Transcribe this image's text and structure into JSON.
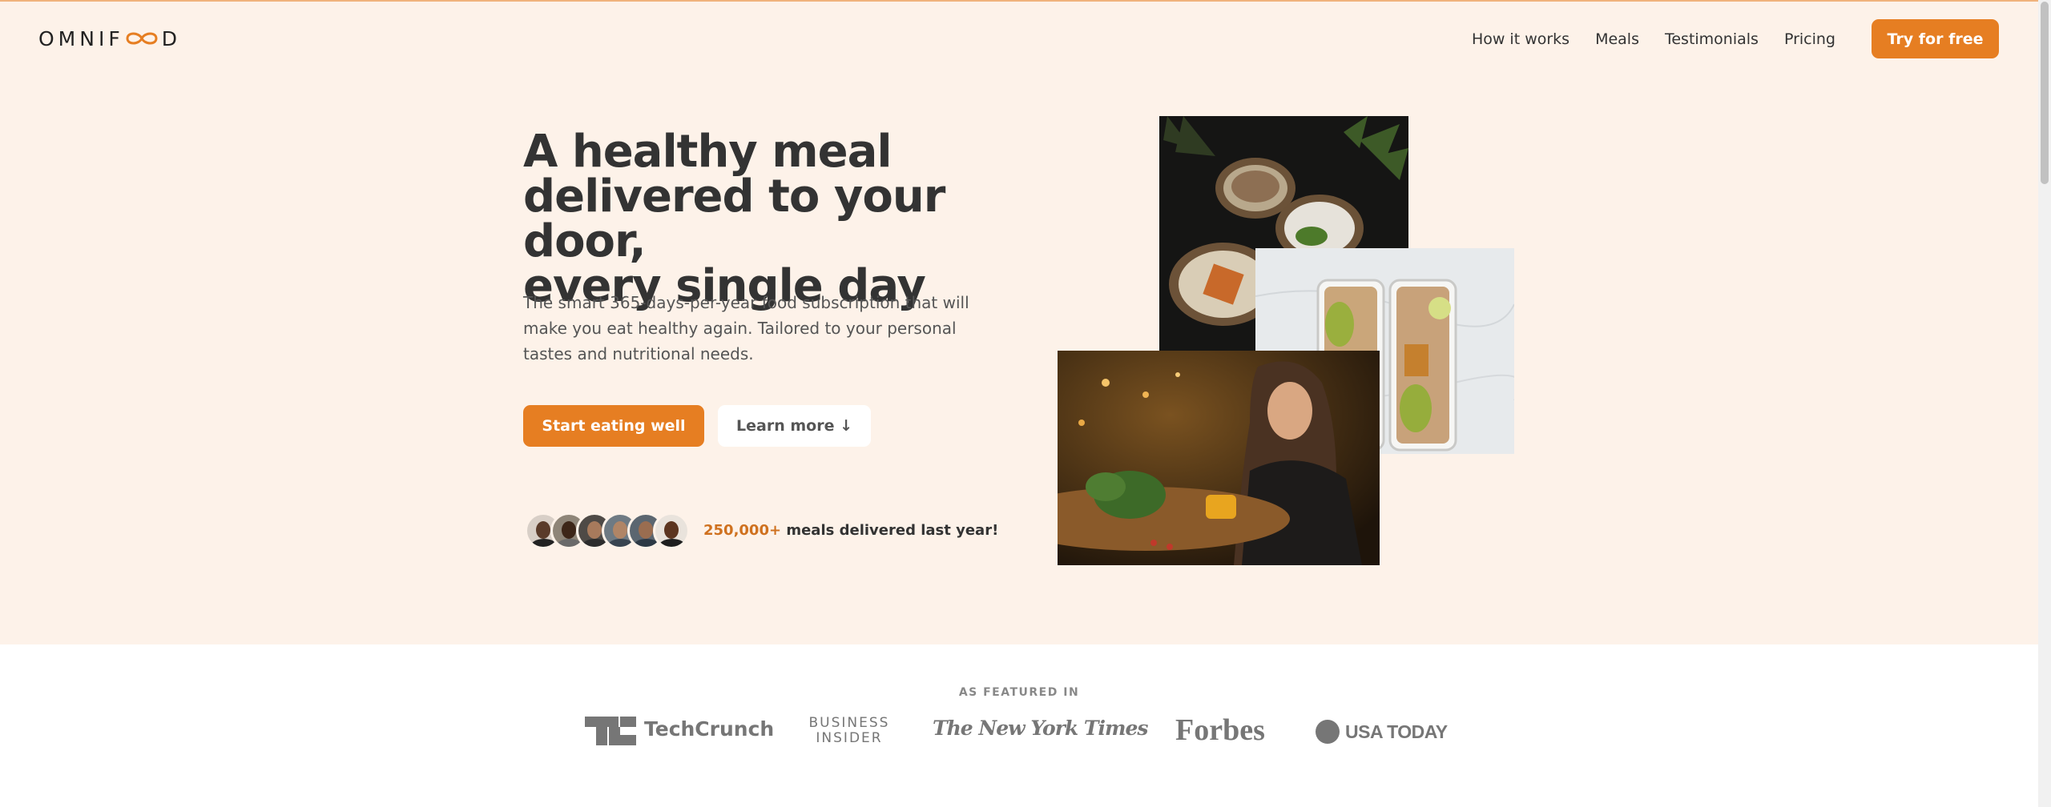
{
  "header": {
    "logo_prefix": "OMNIF",
    "logo_suffix": "D",
    "nav": [
      "How it works",
      "Meals",
      "Testimonials",
      "Pricing"
    ],
    "cta": "Try for free"
  },
  "hero": {
    "title_lines": [
      "A healthy meal",
      "delivered to your door,",
      "every single day"
    ],
    "description": "The smart 365-days-per-year food subscription that will make you eat healthy again. Tailored to your personal tastes and nutritional needs.",
    "primary_button": "Start eating well",
    "secondary_button": "Learn more ↓",
    "meals_count": "250,000+",
    "meals_text": " meals delivered last year!"
  },
  "featured": {
    "title": "AS FEATURED IN",
    "logos": [
      "TechCrunch",
      "Business Insider",
      "The New York Times",
      "Forbes",
      "USA TODAY"
    ],
    "business_insider_lines": [
      "BUSINESS",
      "INSIDER"
    ]
  },
  "colors": {
    "accent": "#e67e22",
    "hero_bg": "#fdf2e9",
    "text": "#333333",
    "logo_gray": "#767676"
  }
}
